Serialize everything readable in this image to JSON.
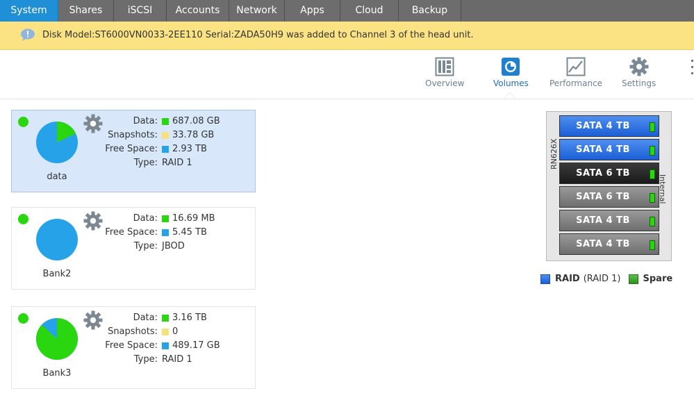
{
  "nav": {
    "tabs": [
      {
        "label": "System"
      },
      {
        "label": "Shares"
      },
      {
        "label": "iSCSI"
      },
      {
        "label": "Accounts"
      },
      {
        "label": "Network"
      },
      {
        "label": "Apps"
      },
      {
        "label": "Cloud"
      },
      {
        "label": "Backup"
      }
    ]
  },
  "notice": {
    "message": "Disk Model:ST6000VN0033-2EE110 Serial:ZADA50H9 was added to Channel 3 of the head unit."
  },
  "subnav": {
    "overview": "Overview",
    "volumes": "Volumes",
    "performance": "Performance",
    "settings": "Settings"
  },
  "colors": {
    "data": "#2ad60f",
    "snapshots": "#f7e17f",
    "free": "#26a3e8",
    "active_tab": "#1f8fd8"
  },
  "volumes": [
    {
      "name": "data",
      "stats": [
        {
          "label": "Data:",
          "value": "687.08 GB",
          "swatch": "data"
        },
        {
          "label": "Snapshots:",
          "value": "33.78 GB",
          "swatch": "snapshots"
        },
        {
          "label": "Free Space:",
          "value": "2.93 TB",
          "swatch": "free"
        },
        {
          "label": "Type:",
          "value": "RAID 1",
          "swatch": null
        }
      ],
      "pie_fraction_data": 0.18
    },
    {
      "name": "Bank2",
      "stats": [
        {
          "label": "Data:",
          "value": "16.69 MB",
          "swatch": "data"
        },
        {
          "label": "Free Space:",
          "value": "5.45 TB",
          "swatch": "free"
        },
        {
          "label": "Type:",
          "value": "JBOD",
          "swatch": null
        }
      ],
      "pie_fraction_data": 0.0
    },
    {
      "name": "Bank3",
      "stats": [
        {
          "label": "Data:",
          "value": "3.16 TB",
          "swatch": "data"
        },
        {
          "label": "Snapshots:",
          "value": "0",
          "swatch": "snapshots"
        },
        {
          "label": "Free Space:",
          "value": "489.17 GB",
          "swatch": "free"
        },
        {
          "label": "Type:",
          "value": "RAID 1",
          "swatch": null
        }
      ],
      "pie_fraction_data": 0.87
    }
  ],
  "chassis": {
    "model": "RN626X",
    "label_right": "Internal",
    "bays": [
      {
        "label": "SATA 4 TB",
        "style": "raid"
      },
      {
        "label": "SATA 4 TB",
        "style": "raid"
      },
      {
        "label": "SATA 6 TB",
        "style": "dark"
      },
      {
        "label": "SATA 6 TB",
        "style": "gray"
      },
      {
        "label": "SATA 4 TB",
        "style": "gray"
      },
      {
        "label": "SATA 4 TB",
        "style": "gray"
      }
    ]
  },
  "legend": {
    "raid_label": "RAID",
    "raid_detail": "(RAID 1)",
    "spare_label": "Spare"
  }
}
